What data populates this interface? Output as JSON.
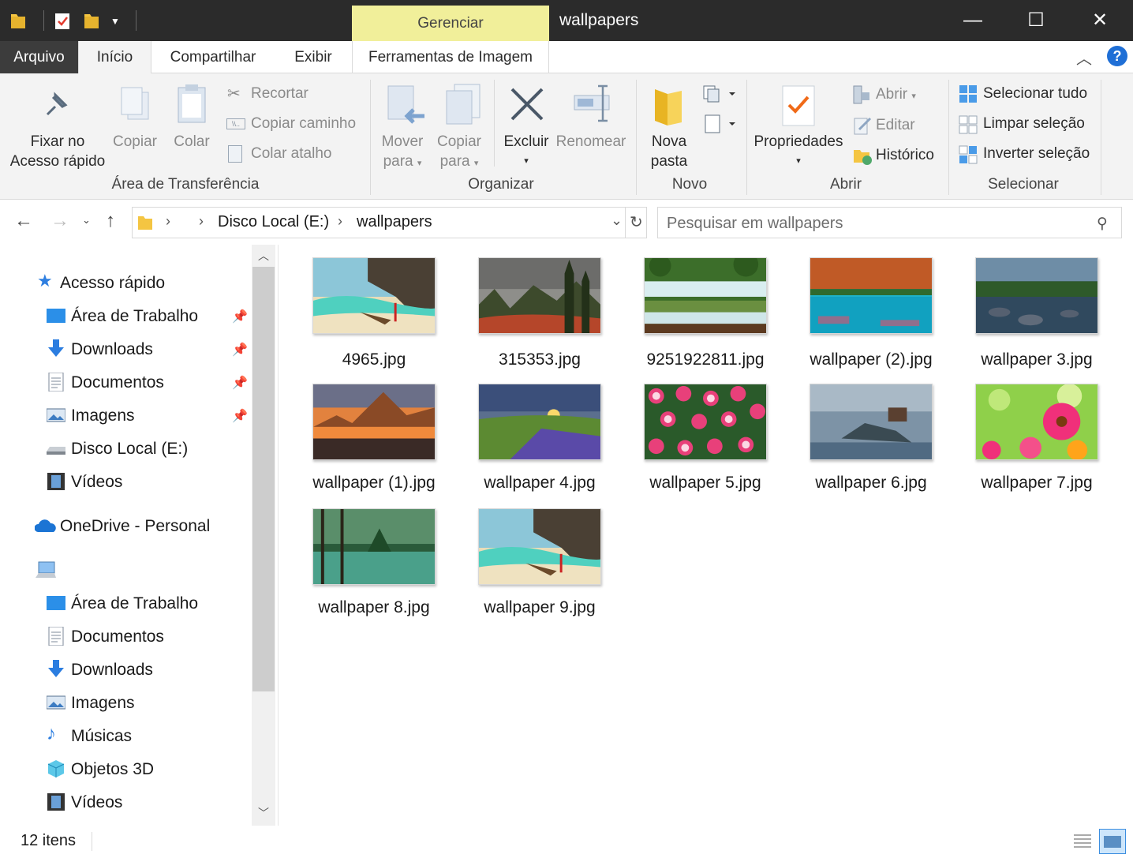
{
  "window": {
    "title": "wallpapers",
    "manage_tab": "Gerenciar",
    "minimize": "—",
    "maximize": "☐",
    "close": "✕"
  },
  "tabs": [
    "Arquivo",
    "Início",
    "Compartilhar",
    "Exibir",
    "Ferramentas de Imagem"
  ],
  "help": "?",
  "ribbon": {
    "clipboard": {
      "pin_line1": "Fixar no",
      "pin_line2": "Acesso rápido",
      "copy": "Copiar",
      "paste": "Colar",
      "cut": "Recortar",
      "copy_path": "Copiar caminho",
      "paste_shortcut": "Colar atalho",
      "group": "Área de Transferência"
    },
    "organize": {
      "move_line1": "Mover",
      "move_line2": "para",
      "copyto_line1": "Copiar",
      "copyto_line2": "para",
      "delete": "Excluir",
      "rename": "Renomear",
      "group": "Organizar"
    },
    "new": {
      "folder_line1": "Nova",
      "folder_line2": "pasta",
      "group": "Novo"
    },
    "open": {
      "properties": "Propriedades",
      "open": "Abrir",
      "edit": "Editar",
      "history": "Histórico",
      "group": "Abrir"
    },
    "select": {
      "select_all": "Selecionar tudo",
      "clear": "Limpar seleção",
      "invert": "Inverter seleção",
      "group": "Selecionar"
    }
  },
  "address": {
    "crumbs": [
      "Disco Local (E:)",
      "wallpapers"
    ],
    "search_placeholder": "Pesquisar em wallpapers"
  },
  "nav": {
    "quick_access": "Acesso rápido",
    "quick_items": [
      "Área de Trabalho",
      "Downloads",
      "Documentos",
      "Imagens",
      "Disco Local (E:)",
      "Vídeos"
    ],
    "onedrive": "OneDrive - Personal",
    "pc_items": [
      "Área de Trabalho",
      "Documentos",
      "Downloads",
      "Imagens",
      "Músicas",
      "Objetos 3D",
      "Vídeos"
    ]
  },
  "files": [
    {
      "name": "4965.jpg",
      "theme": "beach"
    },
    {
      "name": "315353.jpg",
      "theme": "forest-fog"
    },
    {
      "name": "9251922811.jpg",
      "theme": "waterfall"
    },
    {
      "name": "wallpaper  (2).jpg",
      "theme": "lake-autumn"
    },
    {
      "name": "wallpaper  3.jpg",
      "theme": "river-rocks"
    },
    {
      "name": "wallpaper (1).jpg",
      "theme": "mountain-sunset"
    },
    {
      "name": "wallpaper 4.jpg",
      "theme": "lavender-field"
    },
    {
      "name": "wallpaper 5.jpg",
      "theme": "roses"
    },
    {
      "name": "wallpaper 6.jpg",
      "theme": "misty-island"
    },
    {
      "name": "wallpaper 7.jpg",
      "theme": "gerberas"
    },
    {
      "name": "wallpaper 8.jpg",
      "theme": "pine-lake"
    },
    {
      "name": "wallpaper 9.jpg",
      "theme": "beach"
    }
  ],
  "status": {
    "count": "12 itens"
  }
}
